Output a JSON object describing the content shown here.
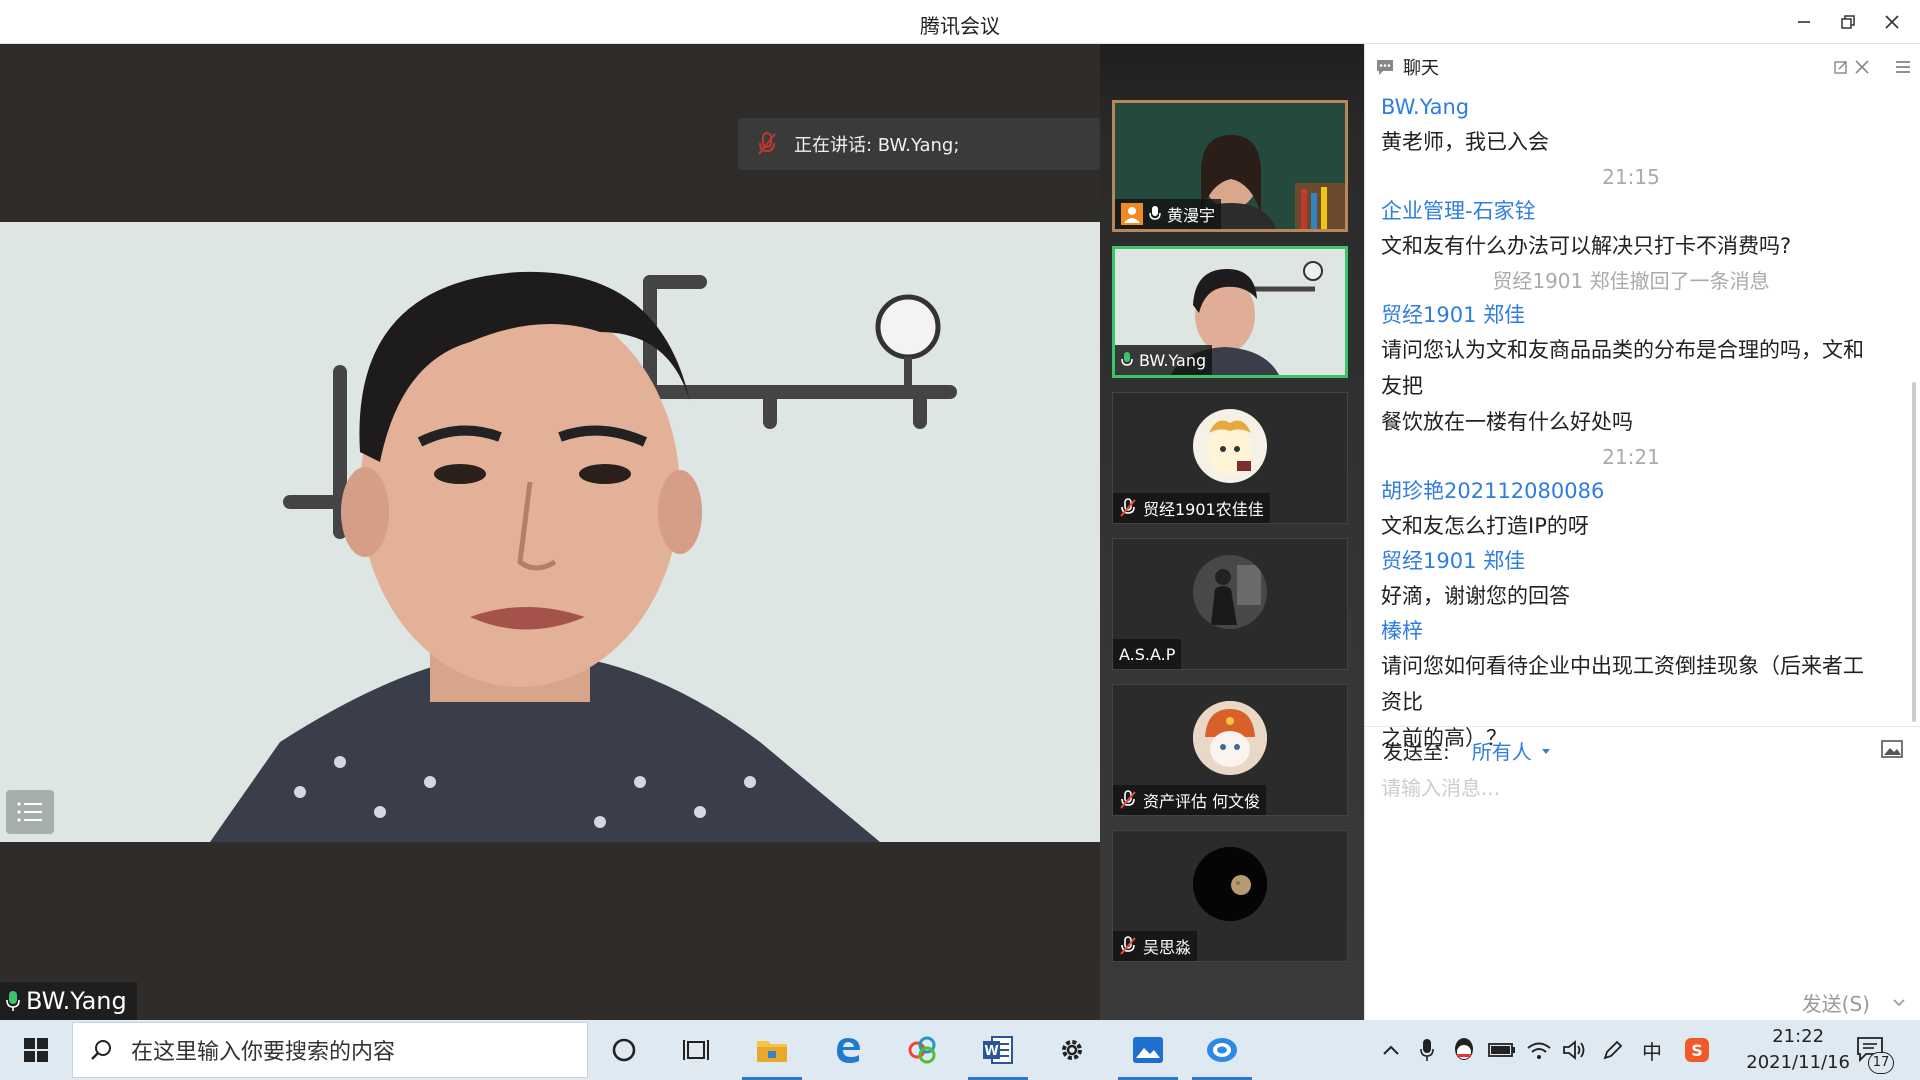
{
  "window": {
    "title": "腾讯会议"
  },
  "speaking": {
    "text": "正在讲话: BW.Yang;"
  },
  "main_video": {
    "name": "BW.Yang"
  },
  "participants": [
    {
      "name": "黄漫宇",
      "mic": "on",
      "host": true
    },
    {
      "name": "BW.Yang",
      "mic": "on",
      "active": true
    },
    {
      "name": "贸经1901农佳佳",
      "mic": "muted"
    },
    {
      "name": "A.S.A.P",
      "mic": "none"
    },
    {
      "name": "资产评估 何文俊",
      "mic": "muted"
    },
    {
      "name": "吴思淼",
      "mic": "muted"
    }
  ],
  "chat": {
    "header": "聊天",
    "messages": [
      {
        "type": "name",
        "text": "BW.Yang"
      },
      {
        "type": "text",
        "text": "黄老师，我已入会"
      },
      {
        "type": "time",
        "text": "21:15"
      },
      {
        "type": "name",
        "text": "企业管理-石家铨"
      },
      {
        "type": "text",
        "text": "文和友有什么办法可以解决只打卡不消费吗?"
      },
      {
        "type": "sys",
        "text": "贸经1901 郑佳撤回了一条消息"
      },
      {
        "type": "name",
        "text": "贸经1901 郑佳"
      },
      {
        "type": "text",
        "text": "请问您认为文和友商品品类的分布是合理的吗，文和友把"
      },
      {
        "type": "text",
        "text": "餐饮放在一楼有什么好处吗"
      },
      {
        "type": "time",
        "text": "21:21"
      },
      {
        "type": "name",
        "text": "胡珍艳202112080086"
      },
      {
        "type": "text",
        "text": "文和友怎么打造IP的呀"
      },
      {
        "type": "name",
        "text": "贸经1901 郑佳"
      },
      {
        "type": "text",
        "text": "好滴，谢谢您的回答"
      },
      {
        "type": "name",
        "text": "榛梓"
      },
      {
        "type": "text",
        "text": "请问您如何看待企业中出现工资倒挂现象（后来者工资比"
      },
      {
        "type": "text",
        "text": "之前的高）？"
      }
    ],
    "send_to_label": "发送至:",
    "send_to_value": "所有人",
    "input_placeholder": "请输入消息...",
    "send_button": "发送(S)"
  },
  "taskbar": {
    "search_placeholder": "在这里输入你要搜索的内容",
    "clock_time": "21:22",
    "clock_date": "2021/11/16",
    "notification_count": "17",
    "ime": "中"
  },
  "colors": {
    "accent": "#2f7de1",
    "active_border": "#3cc46b",
    "taskbar": "#dfe9f1"
  }
}
